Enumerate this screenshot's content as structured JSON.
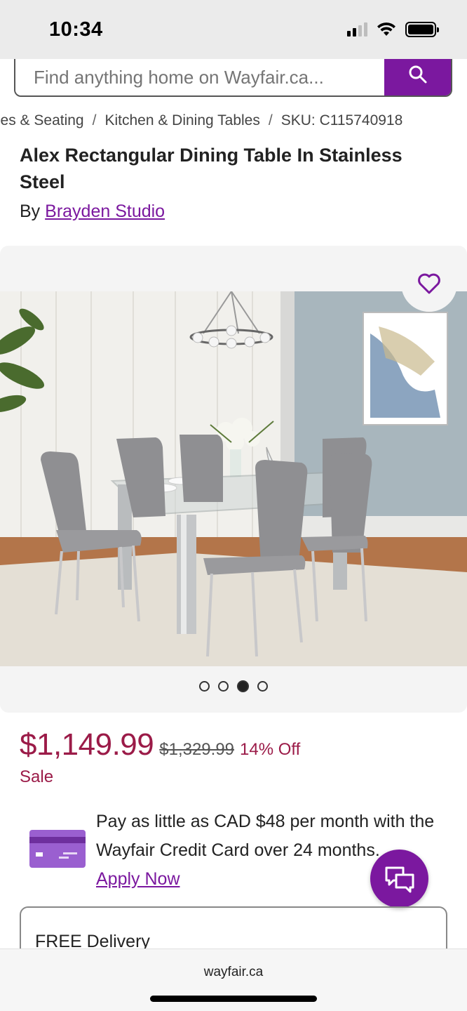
{
  "status_bar": {
    "time": "10:34",
    "icons": [
      "signal-icon",
      "wifi-icon",
      "battery-icon"
    ]
  },
  "search": {
    "placeholder": "Find anything home on Wayfair.ca...",
    "button_icon": "search-icon"
  },
  "breadcrumb": {
    "items": [
      "Tables & Seating",
      "Kitchen & Dining Tables",
      "SKU: C115740918"
    ],
    "separator": "/"
  },
  "product": {
    "title": "Alex Rectangular Dining Table In Stainless Steel",
    "by_prefix": "By",
    "brand": "Brayden Studio"
  },
  "gallery": {
    "favorite_icon": "heart-icon",
    "image_count": 4,
    "active_index": 2
  },
  "pricing": {
    "price": "$1,149.99",
    "was_price": "$1,329.99",
    "discount": "14% Off",
    "sale_label": "Sale"
  },
  "credit": {
    "text": "Pay as little as CAD $48 per month with the Wayfair Credit Card over 24 months.",
    "link": "Apply Now",
    "icon": "credit-card-icon"
  },
  "chat": {
    "icon": "chat-icon"
  },
  "delivery": {
    "label": "FREE Delivery"
  },
  "browser": {
    "url": "wayfair.ca"
  },
  "colors": {
    "brand_purple": "#7b189f",
    "sale_red": "#9b1b48",
    "status_bg": "#ebebeb"
  }
}
